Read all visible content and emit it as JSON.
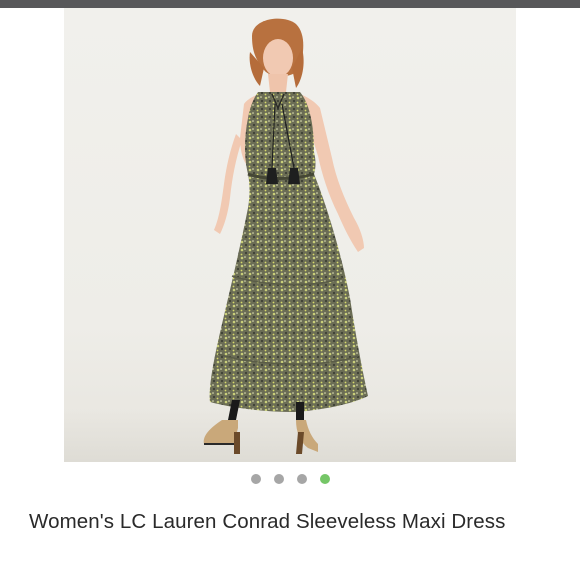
{
  "product": {
    "title": "Women's LC Lauren Conrad Sleeveless Maxi Dress",
    "image": {
      "subject": "model-wearing-dress"
    }
  },
  "carousel": {
    "total": 4,
    "active_index": 3,
    "dot_color": "#a6a6a6",
    "active_dot_color": "#75c667"
  },
  "colors": {
    "top_bar": "#58585a",
    "background": "#ffffff",
    "title_text": "#2a2a2a"
  }
}
